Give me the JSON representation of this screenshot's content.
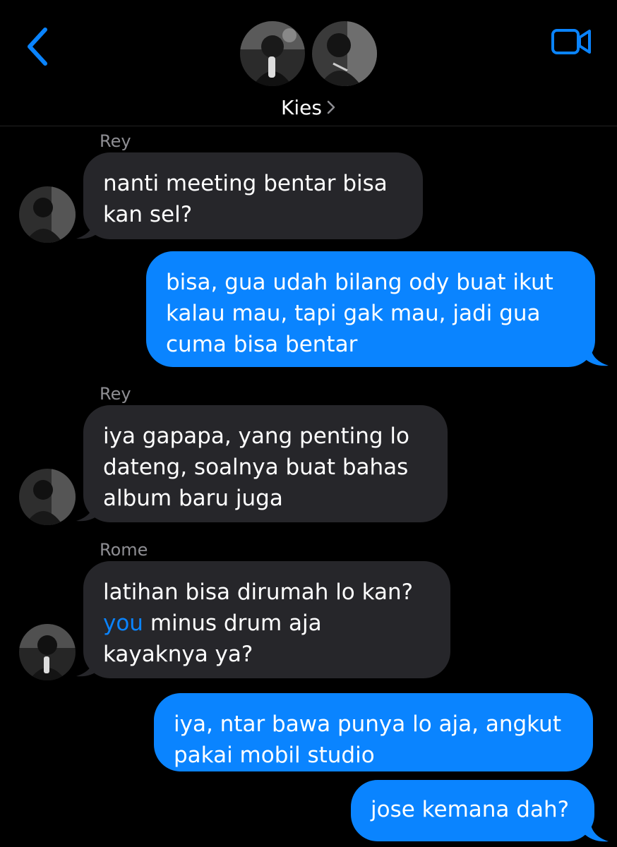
{
  "header": {
    "title": "Kies",
    "back_icon": "chevron-left-icon",
    "video_icon": "video-camera-icon",
    "accent": "#0a84ff"
  },
  "messages": [
    {
      "sender": "Rey",
      "text": "nanti meeting bentar bisa\nkan sel?",
      "direction": "incoming"
    },
    {
      "text": "bisa, gua udah bilang ody buat ikut\nkalau mau, tapi gak mau, jadi gua\ncuma bisa bentar",
      "direction": "outgoing"
    },
    {
      "sender": "Rey",
      "text": "iya gapapa, yang penting lo\ndateng, soalnya buat bahas\nalbum baru juga",
      "direction": "incoming"
    },
    {
      "sender": "Rome",
      "line1": "latihan bisa dirumah lo kan?",
      "mention": "you",
      "line2_rest": " minus drum aja",
      "line3": "kayaknya ya?",
      "direction": "incoming"
    },
    {
      "text": "iya, ntar bawa punya lo aja, angkut\npakai mobil studio",
      "direction": "outgoing"
    },
    {
      "text": "jose kemana dah?",
      "direction": "outgoing"
    }
  ],
  "colors": {
    "background": "#000000",
    "incoming_bubble": "#26262a",
    "outgoing_bubble": "#0a84ff",
    "sender_label": "#8e8e93"
  }
}
